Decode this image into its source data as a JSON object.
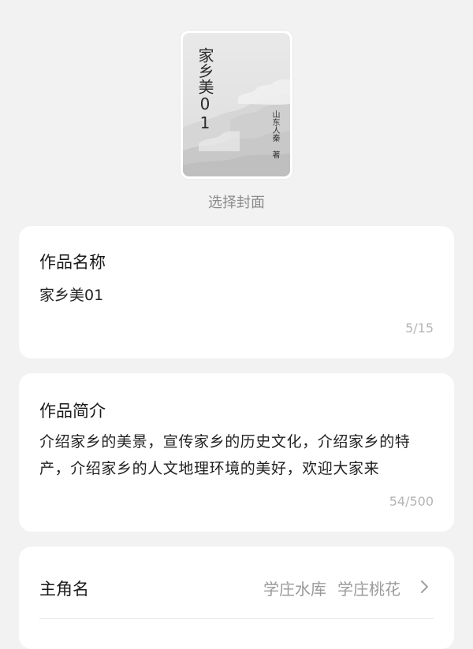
{
  "cover": {
    "title": "家乡美01",
    "author": "山东人秦 著",
    "choose_label": "选择封面"
  },
  "work_name": {
    "label": "作品名称",
    "value": "家乡美01",
    "counter": "5/15"
  },
  "work_intro": {
    "label": "作品简介",
    "value": "介绍家乡的美景，宣传家乡的历史文化，介绍家乡的特产，介绍家乡的人文地理环境的美好，欢迎大家来",
    "counter": "54/500"
  },
  "protagonist": {
    "label": "主角名",
    "values": [
      "学庄水库",
      "学庄桃花"
    ],
    "chevron_icon": "chevron-right-icon"
  }
}
